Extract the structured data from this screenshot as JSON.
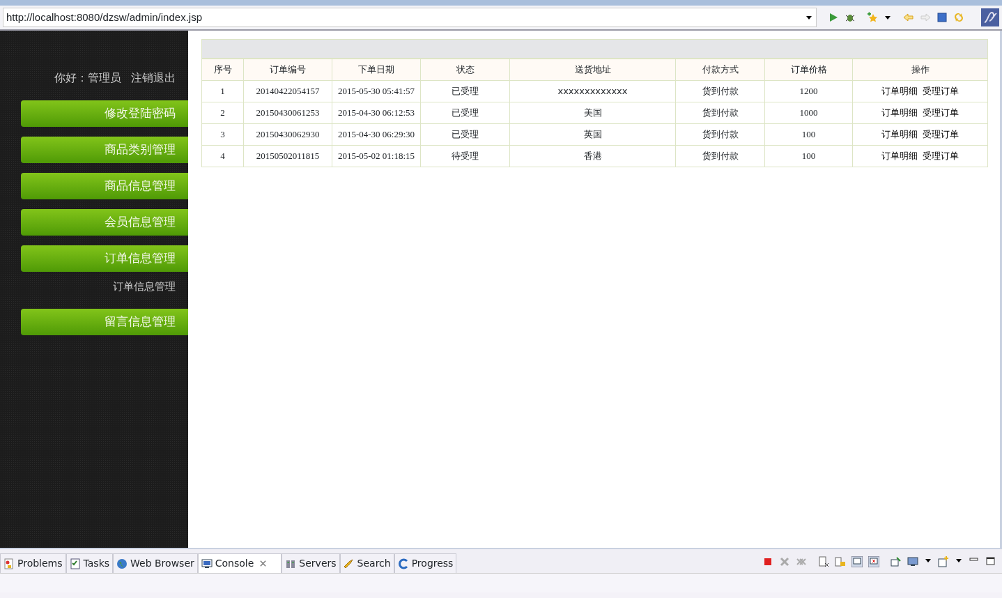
{
  "address_bar": {
    "url": "http://localhost:8080/dzsw/admin/index.jsp"
  },
  "sidebar": {
    "greeting": "你好：管理员",
    "logout": "注销退出",
    "items": [
      {
        "label": "修改登陆密码"
      },
      {
        "label": "商品类别管理"
      },
      {
        "label": "商品信息管理"
      },
      {
        "label": "会员信息管理"
      },
      {
        "label": "订单信息管理",
        "children": [
          {
            "label": "订单信息管理"
          }
        ]
      },
      {
        "label": "留言信息管理"
      }
    ]
  },
  "table": {
    "columns": [
      "序号",
      "订单编号",
      "下单日期",
      "状态",
      "送货地址",
      "付款方式",
      "订单价格",
      "操作"
    ],
    "rows": [
      {
        "cells": [
          "1",
          "20140422054157",
          "2015-05-30 05:41:57",
          "已受理",
          "xxxxxxxxxxxxx",
          "货到付款",
          "1200"
        ],
        "actions": [
          "订单明细",
          "受理订单"
        ]
      },
      {
        "cells": [
          "2",
          "20150430061253",
          "2015-04-30 06:12:53",
          "已受理",
          "美国",
          "货到付款",
          "1000"
        ],
        "actions": [
          "订单明细",
          "受理订单"
        ]
      },
      {
        "cells": [
          "3",
          "20150430062930",
          "2015-04-30 06:29:30",
          "已受理",
          "英国",
          "货到付款",
          "100"
        ],
        "actions": [
          "订单明细",
          "受理订单"
        ]
      },
      {
        "cells": [
          "4",
          "20150502011815",
          "2015-05-02 01:18:15",
          "待受理",
          "香港",
          "货到付款",
          "100"
        ],
        "actions": [
          "订单明细",
          "受理订单"
        ]
      }
    ]
  },
  "views": [
    {
      "kind": "problems",
      "label": "Problems",
      "selected": false
    },
    {
      "kind": "tasks",
      "label": "Tasks",
      "selected": false
    },
    {
      "kind": "browser",
      "label": "Web Browser",
      "selected": false
    },
    {
      "kind": "console",
      "label": "Console",
      "selected": true
    },
    {
      "kind": "servers",
      "label": "Servers",
      "selected": false
    },
    {
      "kind": "search",
      "label": "Search",
      "selected": false
    },
    {
      "kind": "progress",
      "label": "Progress",
      "selected": false
    }
  ]
}
